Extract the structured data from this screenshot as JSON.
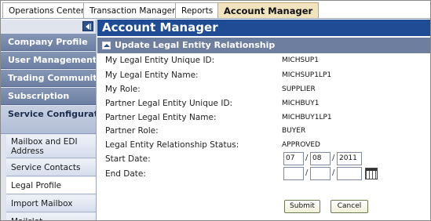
{
  "tabs": [
    "Operations Center",
    "Transaction Manager",
    "Reports",
    "Account Manager"
  ],
  "active_tab": "Account Manager",
  "sidebar": {
    "heads": [
      "Company Profile",
      "User Management",
      "Trading Community",
      "Subscription"
    ],
    "open_head": "Service Configuration",
    "items": [
      "Mailbox and EDI Address",
      "Service Contacts",
      "Legal Profile",
      "Import Mailbox",
      "Mailslot"
    ],
    "active_item": "Legal Profile"
  },
  "main": {
    "title": "Account Manager",
    "section": "Update Legal Entity Relationship",
    "fields": [
      {
        "label": "My Legal Entity Unique ID:",
        "value": "MICHSUP1"
      },
      {
        "label": "My Legal Entity Name:",
        "value": "MICHSUP1LP1"
      },
      {
        "label": "My Role:",
        "value": "SUPPLIER"
      },
      {
        "label": "Partner Legal Entity Unique ID:",
        "value": "MICHBUY1"
      },
      {
        "label": "Partner Legal Entity Name:",
        "value": "MICHBUY1LP1"
      },
      {
        "label": "Partner Role:",
        "value": "BUYER"
      },
      {
        "label": "Legal Entity Relationship Status:",
        "value": "APPROVED"
      }
    ],
    "start_date": {
      "label": "Start Date:",
      "month": "07",
      "day": "08",
      "year": "2011"
    },
    "end_date": {
      "label": "End Date:",
      "month": "",
      "day": "",
      "year": ""
    },
    "date_separator": "/",
    "submit_label": "Submit",
    "cancel_label": "Cancel"
  }
}
